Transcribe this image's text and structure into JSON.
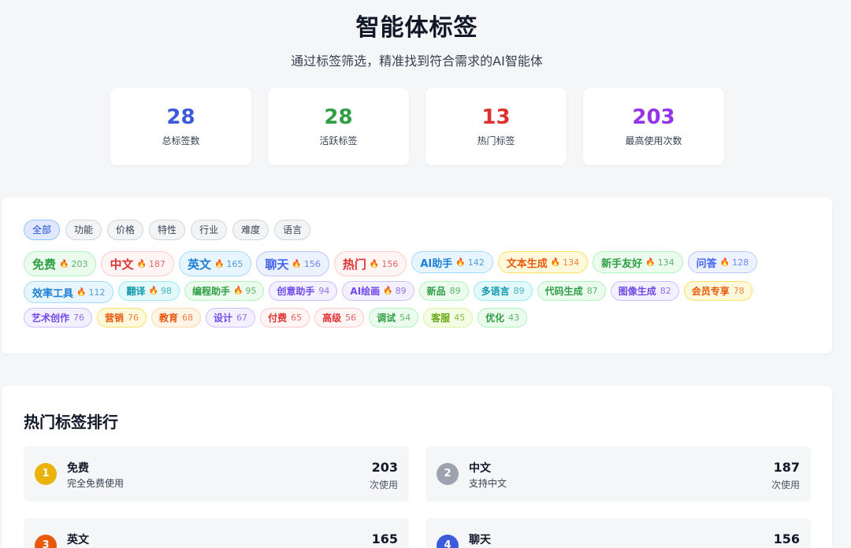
{
  "header": {
    "title": "智能体标签",
    "subtitle": "通过标签筛选，精准找到符合需求的AI智能体"
  },
  "stats": [
    {
      "value": "28",
      "label": "总标签数",
      "color": "#3b5bdb"
    },
    {
      "value": "28",
      "label": "活跃标签",
      "color": "#2f9e44"
    },
    {
      "value": "13",
      "label": "热门标签",
      "color": "#e03131"
    },
    {
      "value": "203",
      "label": "最高使用次数",
      "color": "#9333ea"
    }
  ],
  "filters": {
    "active": "全部",
    "items": [
      "全部",
      "功能",
      "价格",
      "特性",
      "行业",
      "难度",
      "语言"
    ]
  },
  "tags": [
    [
      {
        "label": "免费",
        "count": "203",
        "hot": true,
        "size": "lg",
        "color": "#2f9e44",
        "bg": "#ebfbee",
        "border": "#b2f2bb"
      },
      {
        "label": "中文",
        "count": "187",
        "hot": true,
        "size": "lg",
        "color": "#e03131",
        "bg": "#fff5f5",
        "border": "#ffc9c9"
      },
      {
        "label": "英文",
        "count": "165",
        "hot": true,
        "size": "lg",
        "color": "#1c7ed6",
        "bg": "#e7f5ff",
        "border": "#a5d8ff"
      },
      {
        "label": "聊天",
        "count": "156",
        "hot": true,
        "size": "lg",
        "color": "#4263eb",
        "bg": "#edf2ff",
        "border": "#bac8ff"
      },
      {
        "label": "热门",
        "count": "156",
        "hot": true,
        "size": "lg",
        "color": "#e03131",
        "bg": "#fff5f5",
        "border": "#ffc9c9"
      },
      {
        "label": "AI助手",
        "count": "142",
        "hot": true,
        "size": "md",
        "color": "#1c7ed6",
        "bg": "#e7f5ff",
        "border": "#a5d8ff"
      },
      {
        "label": "文本生成",
        "count": "134",
        "hot": true,
        "size": "md",
        "color": "#e8590c",
        "bg": "#fff9db",
        "border": "#ffe066"
      },
      {
        "label": "新手友好",
        "count": "134",
        "hot": true,
        "size": "md",
        "color": "#2f9e44",
        "bg": "#ebfbee",
        "border": "#b2f2bb"
      },
      {
        "label": "问答",
        "count": "128",
        "hot": true,
        "size": "md",
        "color": "#4263eb",
        "bg": "#edf2ff",
        "border": "#bac8ff"
      }
    ],
    [
      {
        "label": "效率工具",
        "count": "112",
        "hot": true,
        "size": "md",
        "color": "#1c7ed6",
        "bg": "#e7f5ff",
        "border": "#a5d8ff"
      },
      {
        "label": "翻译",
        "count": "98",
        "hot": true,
        "size": "sm",
        "color": "#1098ad",
        "bg": "#e3fafc",
        "border": "#99e9f2"
      },
      {
        "label": "编程助手",
        "count": "95",
        "hot": true,
        "size": "sm",
        "color": "#2f9e44",
        "bg": "#ebfbee",
        "border": "#b2f2bb"
      },
      {
        "label": "创意助手",
        "count": "94",
        "hot": false,
        "size": "sm",
        "color": "#7048e8",
        "bg": "#f3f0ff",
        "border": "#d0bfff"
      },
      {
        "label": "AI绘画",
        "count": "89",
        "hot": true,
        "size": "sm",
        "color": "#7048e8",
        "bg": "#f3f0ff",
        "border": "#d0bfff"
      },
      {
        "label": "新品",
        "count": "89",
        "hot": false,
        "size": "sm",
        "color": "#2f9e44",
        "bg": "#ebfbee",
        "border": "#b2f2bb"
      },
      {
        "label": "多语言",
        "count": "89",
        "hot": false,
        "size": "sm",
        "color": "#1098ad",
        "bg": "#e3fafc",
        "border": "#99e9f2"
      },
      {
        "label": "代码生成",
        "count": "87",
        "hot": false,
        "size": "sm",
        "color": "#2f9e44",
        "bg": "#ebfbee",
        "border": "#b2f2bb"
      },
      {
        "label": "图像生成",
        "count": "82",
        "hot": false,
        "size": "sm",
        "color": "#7048e8",
        "bg": "#f3f0ff",
        "border": "#d0bfff"
      },
      {
        "label": "会员专享",
        "count": "78",
        "hot": false,
        "size": "sm",
        "color": "#e8590c",
        "bg": "#fff9db",
        "border": "#ffe066"
      }
    ],
    [
      {
        "label": "艺术创作",
        "count": "76",
        "hot": false,
        "size": "sm",
        "color": "#7048e8",
        "bg": "#f3f0ff",
        "border": "#d0bfff"
      },
      {
        "label": "营销",
        "count": "76",
        "hot": false,
        "size": "sm",
        "color": "#e8590c",
        "bg": "#fff9db",
        "border": "#ffe066"
      },
      {
        "label": "教育",
        "count": "68",
        "hot": false,
        "size": "sm",
        "color": "#e8590c",
        "bg": "#fff4e6",
        "border": "#ffd8a8"
      },
      {
        "label": "设计",
        "count": "67",
        "hot": false,
        "size": "sm",
        "color": "#7048e8",
        "bg": "#f3f0ff",
        "border": "#d0bfff"
      },
      {
        "label": "付费",
        "count": "65",
        "hot": false,
        "size": "sm",
        "color": "#e03131",
        "bg": "#fff5f5",
        "border": "#ffc9c9"
      },
      {
        "label": "高级",
        "count": "56",
        "hot": false,
        "size": "sm",
        "color": "#e03131",
        "bg": "#fff5f5",
        "border": "#ffc9c9"
      },
      {
        "label": "调试",
        "count": "54",
        "hot": false,
        "size": "sm",
        "color": "#2f9e44",
        "bg": "#ebfbee",
        "border": "#b2f2bb"
      },
      {
        "label": "客服",
        "count": "45",
        "hot": false,
        "size": "sm",
        "color": "#66a80f",
        "bg": "#f4fce3",
        "border": "#d8f5a2"
      },
      {
        "label": "优化",
        "count": "43",
        "hot": false,
        "size": "sm",
        "color": "#2f9e44",
        "bg": "#ebfbee",
        "border": "#b2f2bb"
      }
    ]
  ],
  "ranking": {
    "title": "热门标签排行",
    "items": [
      {
        "rank": "1",
        "name": "免费",
        "desc": "完全免费使用",
        "count": "203",
        "unit": "次使用",
        "badge_color": "#eab308"
      },
      {
        "rank": "2",
        "name": "中文",
        "desc": "支持中文",
        "count": "187",
        "unit": "次使用",
        "badge_color": "#9ca3af"
      },
      {
        "rank": "3",
        "name": "英文",
        "desc": "",
        "count": "165",
        "unit": "",
        "badge_color": "#ea580c"
      },
      {
        "rank": "4",
        "name": "聊天",
        "desc": "",
        "count": "156",
        "unit": "",
        "badge_color": "#3b5bdb"
      }
    ]
  }
}
